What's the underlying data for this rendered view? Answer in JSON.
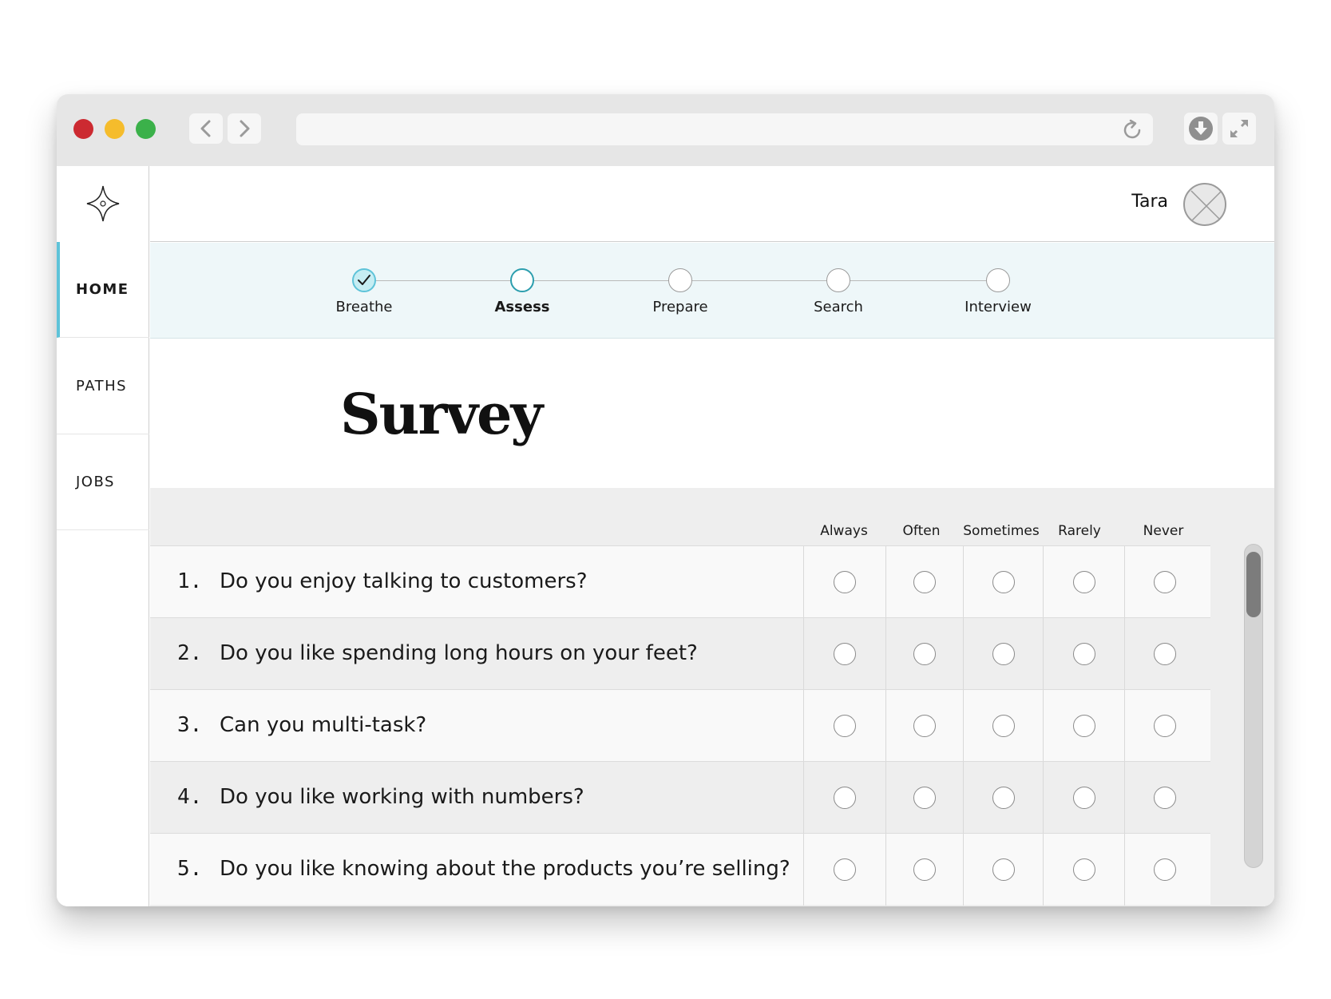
{
  "browser": {
    "url": "",
    "controls": {
      "back_icon": "chevron-left-icon",
      "forward_icon": "chevron-right-icon",
      "reload_icon": "reload-icon",
      "download_icon": "download-icon",
      "expand_icon": "expand-icon"
    }
  },
  "colors": {
    "accent": "#5ec3d9",
    "accent_dark": "#2c9eae",
    "band_bg": "#eef7f9"
  },
  "sidebar": {
    "logo_icon": "four-point-star-icon",
    "items": [
      {
        "label": "HOME",
        "active": true
      },
      {
        "label": "PATHS",
        "active": false
      },
      {
        "label": "JOBS",
        "active": false
      }
    ]
  },
  "header": {
    "user_name": "Tara",
    "avatar_icon": "avatar-placeholder-icon"
  },
  "stepper": {
    "steps": [
      {
        "label": "Breathe",
        "state": "done"
      },
      {
        "label": "Assess",
        "state": "current"
      },
      {
        "label": "Prepare",
        "state": "todo"
      },
      {
        "label": "Search",
        "state": "todo"
      },
      {
        "label": "Interview",
        "state": "todo"
      }
    ],
    "close_icon": "close-circle-icon"
  },
  "page": {
    "title": "Survey"
  },
  "survey": {
    "columns": [
      "Always",
      "Often",
      "Sometimes",
      "Rarely",
      "Never"
    ],
    "questions": [
      {
        "number": "1.",
        "text": "Do you enjoy talking to customers?"
      },
      {
        "number": "2.",
        "text": "Do you like spending long hours on your feet?"
      },
      {
        "number": "3.",
        "text": "Can you multi-task?"
      },
      {
        "number": "4.",
        "text": "Do you like working with numbers?"
      },
      {
        "number": "5.",
        "text": "Do you like knowing about the products you’re selling?"
      }
    ]
  }
}
